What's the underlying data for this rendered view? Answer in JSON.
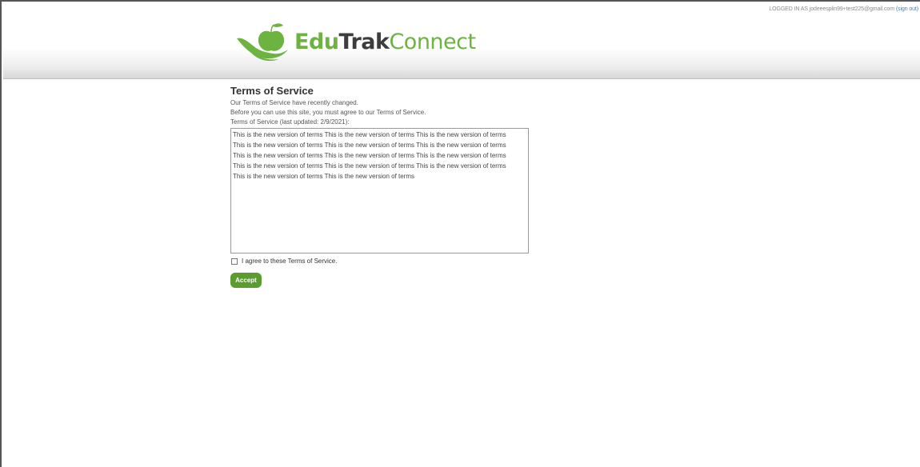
{
  "header": {
    "login_prefix": "LOGGED IN AS",
    "user_email": "jodeeesplin99+test225@gmail.com",
    "sign_out_label": "(sign out)",
    "logo": {
      "part1": "Edu",
      "part2": "Trak",
      "part3": "Connect",
      "icon": "apple-in-hand-icon"
    }
  },
  "tos": {
    "title": "Terms of Service",
    "notice": "Our Terms of Service have recently changed.",
    "instruction": "Before you can use this site, you must agree to our Terms of Service.",
    "updated_label": "Terms of Service (last updated: 2/9/2021):",
    "lines": [
      "This is the new version of terms This is the new version of terms This is the new version of terms",
      "This is the new version of terms This is the new version of terms This is the new version of terms",
      "This is the new version of terms This is the new version of terms This is the new version of terms",
      "This is the new version of terms This is the new version of terms This is the new version of terms",
      "This is the new version of terms This is the new version of terms"
    ],
    "agree_label": "I agree to these Terms of Service.",
    "agree_checked": false,
    "accept_label": "Accept"
  },
  "colors": {
    "brand_green": "#6db33f",
    "button_green": "#5a9c2e",
    "link_blue": "#4a7fb5"
  }
}
